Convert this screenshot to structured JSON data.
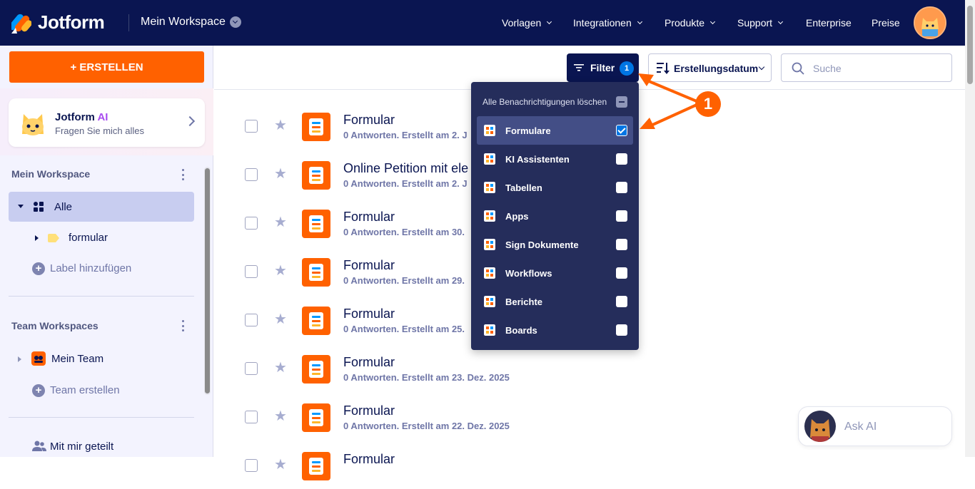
{
  "header": {
    "logo_text": "Jotform",
    "workspace": "Mein Workspace",
    "nav": [
      {
        "label": "Vorlagen"
      },
      {
        "label": "Integrationen"
      },
      {
        "label": "Produkte"
      },
      {
        "label": "Support"
      },
      {
        "label": "Enterprise"
      },
      {
        "label": "Preise"
      }
    ]
  },
  "sidebar": {
    "create_label": "+ ERSTELLEN",
    "ai": {
      "title": "Jotform",
      "title_accent": "AI",
      "subtitle": "Fragen Sie mich alles"
    },
    "my_workspace": {
      "title": "Mein Workspace",
      "all_label": "Alle",
      "folder_label": "formular",
      "add_label": "Label hinzufügen"
    },
    "team": {
      "title": "Team Workspaces",
      "team_label": "Mein Team",
      "create_label": "Team erstellen"
    },
    "shared_label": "Mit mir geteilt"
  },
  "toolbar": {
    "filter_label": "Filter",
    "filter_count": "1",
    "sort_label": "Erstellungsdatum",
    "search_placeholder": "Suche"
  },
  "forms": [
    {
      "title": "Formular",
      "subtitle": "0 Antworten. Erstellt am 2. J"
    },
    {
      "title": "Online Petition mit ele",
      "subtitle": "0 Antworten. Erstellt am 2. J"
    },
    {
      "title": "Formular",
      "subtitle": "0 Antworten. Erstellt am 30."
    },
    {
      "title": "Formular",
      "subtitle": "0 Antworten. Erstellt am 29."
    },
    {
      "title": "Formular",
      "subtitle": "0 Antworten. Erstellt am 25."
    },
    {
      "title": "Formular",
      "subtitle": "0 Antworten. Erstellt am 23. Dez. 2025"
    },
    {
      "title": "Formular",
      "subtitle": "0 Antworten. Erstellt am 22. Dez. 2025"
    },
    {
      "title": "Formular",
      "subtitle": ""
    }
  ],
  "filter_menu": {
    "clear_label": "Alle Benachrichtigungen löschen",
    "items": [
      {
        "label": "Formulare",
        "checked": true,
        "color": "#ff6100"
      },
      {
        "label": "KI Assistenten",
        "checked": false,
        "color": "#ffffff"
      },
      {
        "label": "Tabellen",
        "checked": false,
        "color": "#ffffff"
      },
      {
        "label": "Apps",
        "checked": false,
        "color": "#ffffff"
      },
      {
        "label": "Sign Dokumente",
        "checked": false,
        "color": "#ffffff"
      },
      {
        "label": "Workflows",
        "checked": false,
        "color": "#ffffff"
      },
      {
        "label": "Berichte",
        "checked": false,
        "color": "#ffffff"
      },
      {
        "label": "Boards",
        "checked": false,
        "color": "#ffffff"
      }
    ]
  },
  "ask_ai_label": "Ask AI",
  "annotation": {
    "callout_number": "1"
  }
}
